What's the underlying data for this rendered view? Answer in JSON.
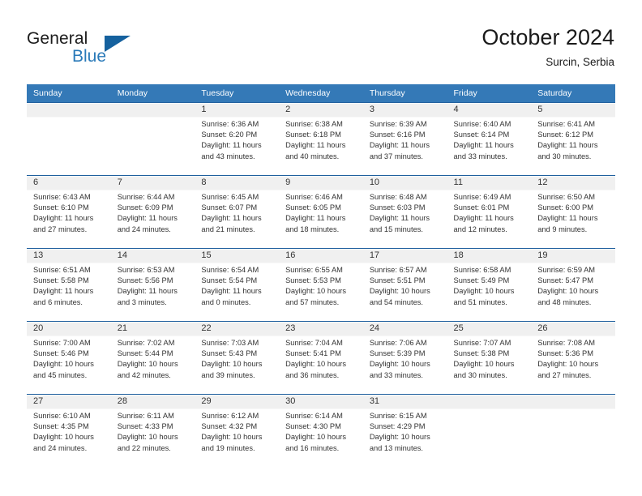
{
  "brand": {
    "name_part1": "General",
    "name_part2": "Blue",
    "logo_icon": "triangle-flag-icon"
  },
  "header": {
    "month_title": "October 2024",
    "location": "Surcin, Serbia",
    "accent_color": "#3479b7",
    "separator_color": "#1f5f9e",
    "daynum_band_color": "#f0f0f0"
  },
  "weekday_headers": [
    "Sunday",
    "Monday",
    "Tuesday",
    "Wednesday",
    "Thursday",
    "Friday",
    "Saturday"
  ],
  "weeks": [
    [
      {
        "day": "",
        "empty": true,
        "sunrise": "",
        "sunset": "",
        "daylight1": "",
        "daylight2": ""
      },
      {
        "day": "",
        "empty": true,
        "sunrise": "",
        "sunset": "",
        "daylight1": "",
        "daylight2": ""
      },
      {
        "day": "1",
        "sunrise": "Sunrise: 6:36 AM",
        "sunset": "Sunset: 6:20 PM",
        "daylight1": "Daylight: 11 hours",
        "daylight2": "and 43 minutes."
      },
      {
        "day": "2",
        "sunrise": "Sunrise: 6:38 AM",
        "sunset": "Sunset: 6:18 PM",
        "daylight1": "Daylight: 11 hours",
        "daylight2": "and 40 minutes."
      },
      {
        "day": "3",
        "sunrise": "Sunrise: 6:39 AM",
        "sunset": "Sunset: 6:16 PM",
        "daylight1": "Daylight: 11 hours",
        "daylight2": "and 37 minutes."
      },
      {
        "day": "4",
        "sunrise": "Sunrise: 6:40 AM",
        "sunset": "Sunset: 6:14 PM",
        "daylight1": "Daylight: 11 hours",
        "daylight2": "and 33 minutes."
      },
      {
        "day": "5",
        "sunrise": "Sunrise: 6:41 AM",
        "sunset": "Sunset: 6:12 PM",
        "daylight1": "Daylight: 11 hours",
        "daylight2": "and 30 minutes."
      }
    ],
    [
      {
        "day": "6",
        "sunrise": "Sunrise: 6:43 AM",
        "sunset": "Sunset: 6:10 PM",
        "daylight1": "Daylight: 11 hours",
        "daylight2": "and 27 minutes."
      },
      {
        "day": "7",
        "sunrise": "Sunrise: 6:44 AM",
        "sunset": "Sunset: 6:09 PM",
        "daylight1": "Daylight: 11 hours",
        "daylight2": "and 24 minutes."
      },
      {
        "day": "8",
        "sunrise": "Sunrise: 6:45 AM",
        "sunset": "Sunset: 6:07 PM",
        "daylight1": "Daylight: 11 hours",
        "daylight2": "and 21 minutes."
      },
      {
        "day": "9",
        "sunrise": "Sunrise: 6:46 AM",
        "sunset": "Sunset: 6:05 PM",
        "daylight1": "Daylight: 11 hours",
        "daylight2": "and 18 minutes."
      },
      {
        "day": "10",
        "sunrise": "Sunrise: 6:48 AM",
        "sunset": "Sunset: 6:03 PM",
        "daylight1": "Daylight: 11 hours",
        "daylight2": "and 15 minutes."
      },
      {
        "day": "11",
        "sunrise": "Sunrise: 6:49 AM",
        "sunset": "Sunset: 6:01 PM",
        "daylight1": "Daylight: 11 hours",
        "daylight2": "and 12 minutes."
      },
      {
        "day": "12",
        "sunrise": "Sunrise: 6:50 AM",
        "sunset": "Sunset: 6:00 PM",
        "daylight1": "Daylight: 11 hours",
        "daylight2": "and 9 minutes."
      }
    ],
    [
      {
        "day": "13",
        "sunrise": "Sunrise: 6:51 AM",
        "sunset": "Sunset: 5:58 PM",
        "daylight1": "Daylight: 11 hours",
        "daylight2": "and 6 minutes."
      },
      {
        "day": "14",
        "sunrise": "Sunrise: 6:53 AM",
        "sunset": "Sunset: 5:56 PM",
        "daylight1": "Daylight: 11 hours",
        "daylight2": "and 3 minutes."
      },
      {
        "day": "15",
        "sunrise": "Sunrise: 6:54 AM",
        "sunset": "Sunset: 5:54 PM",
        "daylight1": "Daylight: 11 hours",
        "daylight2": "and 0 minutes."
      },
      {
        "day": "16",
        "sunrise": "Sunrise: 6:55 AM",
        "sunset": "Sunset: 5:53 PM",
        "daylight1": "Daylight: 10 hours",
        "daylight2": "and 57 minutes."
      },
      {
        "day": "17",
        "sunrise": "Sunrise: 6:57 AM",
        "sunset": "Sunset: 5:51 PM",
        "daylight1": "Daylight: 10 hours",
        "daylight2": "and 54 minutes."
      },
      {
        "day": "18",
        "sunrise": "Sunrise: 6:58 AM",
        "sunset": "Sunset: 5:49 PM",
        "daylight1": "Daylight: 10 hours",
        "daylight2": "and 51 minutes."
      },
      {
        "day": "19",
        "sunrise": "Sunrise: 6:59 AM",
        "sunset": "Sunset: 5:47 PM",
        "daylight1": "Daylight: 10 hours",
        "daylight2": "and 48 minutes."
      }
    ],
    [
      {
        "day": "20",
        "sunrise": "Sunrise: 7:00 AM",
        "sunset": "Sunset: 5:46 PM",
        "daylight1": "Daylight: 10 hours",
        "daylight2": "and 45 minutes."
      },
      {
        "day": "21",
        "sunrise": "Sunrise: 7:02 AM",
        "sunset": "Sunset: 5:44 PM",
        "daylight1": "Daylight: 10 hours",
        "daylight2": "and 42 minutes."
      },
      {
        "day": "22",
        "sunrise": "Sunrise: 7:03 AM",
        "sunset": "Sunset: 5:43 PM",
        "daylight1": "Daylight: 10 hours",
        "daylight2": "and 39 minutes."
      },
      {
        "day": "23",
        "sunrise": "Sunrise: 7:04 AM",
        "sunset": "Sunset: 5:41 PM",
        "daylight1": "Daylight: 10 hours",
        "daylight2": "and 36 minutes."
      },
      {
        "day": "24",
        "sunrise": "Sunrise: 7:06 AM",
        "sunset": "Sunset: 5:39 PM",
        "daylight1": "Daylight: 10 hours",
        "daylight2": "and 33 minutes."
      },
      {
        "day": "25",
        "sunrise": "Sunrise: 7:07 AM",
        "sunset": "Sunset: 5:38 PM",
        "daylight1": "Daylight: 10 hours",
        "daylight2": "and 30 minutes."
      },
      {
        "day": "26",
        "sunrise": "Sunrise: 7:08 AM",
        "sunset": "Sunset: 5:36 PM",
        "daylight1": "Daylight: 10 hours",
        "daylight2": "and 27 minutes."
      }
    ],
    [
      {
        "day": "27",
        "sunrise": "Sunrise: 6:10 AM",
        "sunset": "Sunset: 4:35 PM",
        "daylight1": "Daylight: 10 hours",
        "daylight2": "and 24 minutes."
      },
      {
        "day": "28",
        "sunrise": "Sunrise: 6:11 AM",
        "sunset": "Sunset: 4:33 PM",
        "daylight1": "Daylight: 10 hours",
        "daylight2": "and 22 minutes."
      },
      {
        "day": "29",
        "sunrise": "Sunrise: 6:12 AM",
        "sunset": "Sunset: 4:32 PM",
        "daylight1": "Daylight: 10 hours",
        "daylight2": "and 19 minutes."
      },
      {
        "day": "30",
        "sunrise": "Sunrise: 6:14 AM",
        "sunset": "Sunset: 4:30 PM",
        "daylight1": "Daylight: 10 hours",
        "daylight2": "and 16 minutes."
      },
      {
        "day": "31",
        "sunrise": "Sunrise: 6:15 AM",
        "sunset": "Sunset: 4:29 PM",
        "daylight1": "Daylight: 10 hours",
        "daylight2": "and 13 minutes."
      },
      {
        "day": "",
        "empty": true,
        "sunrise": "",
        "sunset": "",
        "daylight1": "",
        "daylight2": ""
      },
      {
        "day": "",
        "empty": true,
        "sunrise": "",
        "sunset": "",
        "daylight1": "",
        "daylight2": ""
      }
    ]
  ]
}
